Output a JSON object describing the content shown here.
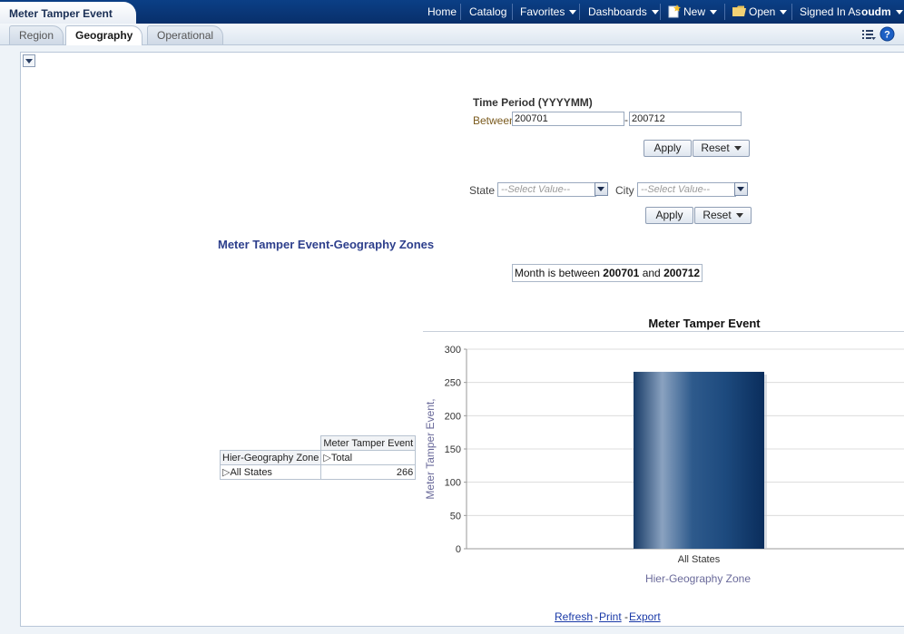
{
  "header": {
    "app_title": "Meter Tamper Event",
    "nav": {
      "home": "Home",
      "catalog": "Catalog",
      "favorites": "Favorites",
      "dashboards": "Dashboards",
      "new": "New",
      "open": "Open",
      "signed_in_label": "Signed In As",
      "user": "oudm"
    }
  },
  "tabs": [
    "Region",
    "Geography",
    "Operational"
  ],
  "active_tab": "Geography",
  "time_prompt": {
    "title": "Time Period (YYYYMM)",
    "between_label": "Between",
    "from_value": "200701",
    "separator": "-",
    "to_value": "200712",
    "apply_label": "Apply",
    "reset_label": "Reset"
  },
  "location_prompt": {
    "state_label": "State",
    "state_placeholder": "--Select Value--",
    "city_label": "City",
    "city_placeholder": "--Select Value--",
    "apply_label": "Apply",
    "reset_label": "Reset"
  },
  "report_title": "Meter Tamper Event-Geography Zones",
  "filter": {
    "prefix": "Month is between",
    "from": "200701",
    "conj": "and",
    "to": "200712"
  },
  "pivot": {
    "measure_header": "Meter Tamper Event",
    "row_header": "Hier-Geography Zone",
    "column_member": "Total",
    "rows": [
      {
        "label": "All States",
        "value": "266"
      }
    ]
  },
  "chart_data": {
    "type": "bar",
    "title": "Meter Tamper Event",
    "xlabel": "Hier-Geography Zone",
    "ylabel": "Meter Tamper Event,",
    "categories": [
      "All States"
    ],
    "values": [
      266
    ],
    "ylim": [
      0,
      300
    ],
    "yticks": [
      0,
      50,
      100,
      150,
      200,
      250,
      300
    ],
    "grid": true,
    "bar_color": "#1f4a7c"
  },
  "footer": {
    "refresh": "Refresh",
    "print": "Print",
    "export": "Export",
    "dash": "-"
  },
  "colors": {
    "header_bg": "#0b3f86",
    "title_blue": "#2d3f8c",
    "link_blue": "#1a3aa8"
  }
}
